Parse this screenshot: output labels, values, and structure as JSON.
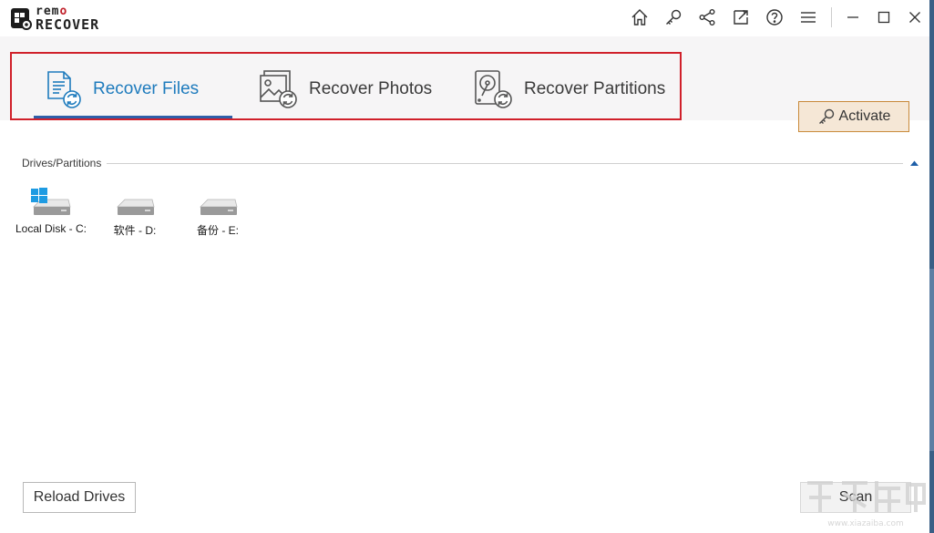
{
  "app": {
    "logo_text_top": "remo",
    "logo_text_bottom": "RECOVER"
  },
  "toolbar": {
    "icons": [
      "home-icon",
      "key-icon",
      "share-icon",
      "external-link-icon",
      "help-icon",
      "menu-icon"
    ],
    "window_controls": [
      "minimize-icon",
      "maximize-icon",
      "close-icon"
    ]
  },
  "tabs": [
    {
      "label": "Recover Files",
      "icon": "recover-files-icon",
      "active": true
    },
    {
      "label": "Recover Photos",
      "icon": "recover-photos-icon",
      "active": false
    },
    {
      "label": "Recover Partitions",
      "icon": "recover-partitions-icon",
      "active": false
    }
  ],
  "activate": {
    "label": "Activate"
  },
  "drives": {
    "title": "Drives/Partitions",
    "items": [
      {
        "label": "Local Disk - C:",
        "icon": "windows-drive-icon"
      },
      {
        "label": "软件 - D:",
        "icon": "drive-icon"
      },
      {
        "label": "备份 - E:",
        "icon": "drive-icon"
      }
    ]
  },
  "buttons": {
    "reload": "Reload Drives",
    "scan": "Scan"
  },
  "colors": {
    "accent": "#1e7bbd",
    "highlight_border": "#d0202a",
    "tab_underline": "#2e5fa8",
    "activate_bg": "#f5e7d6",
    "activate_border": "#c98a3a"
  }
}
